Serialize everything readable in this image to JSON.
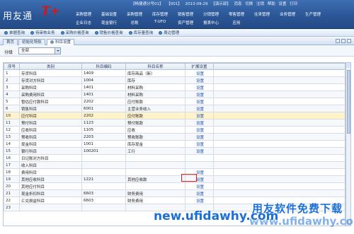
{
  "app": {
    "brand": "用友通",
    "product": "T+",
    "status": [
      "【畅捷通分号01】",
      "【001】",
      "2013-09-29",
      "【演示部】",
      "消息",
      "切换",
      "注销",
      "帮助",
      "设置",
      "打印"
    ]
  },
  "menu": {
    "row1": [
      "采购管理",
      "基础设置",
      "采购管理",
      "库存管理",
      "销售管理",
      "分销管理",
      "零售管理",
      "往来管理",
      "业务管理",
      "生产管理"
    ],
    "row2": [
      "企业日志",
      "现金银行",
      "总账",
      "T-UFO",
      "资产管理",
      "报表中心",
      "应用"
    ]
  },
  "quickbar": [
    "单据查询",
    "待审核业务",
    "采购价格查询",
    "销售价格查询",
    "库存量查询",
    "周边管理"
  ],
  "tabs": [
    {
      "label": "首页",
      "active": false
    },
    {
      "label": "初始化导航",
      "active": false
    },
    {
      "label": "科目设置",
      "active": true
    }
  ],
  "filter": {
    "label": "分级",
    "value": "全部"
  },
  "table": {
    "headers": [
      "序号",
      "类别",
      "科目编码",
      "科目名称",
      "扩展设置"
    ],
    "rows": [
      [
        "1",
        "存货科目",
        "1409",
        "库存商品（新）",
        "设置"
      ],
      [
        "2",
        "存货对方科目",
        "1004",
        "库存",
        "设置"
      ],
      [
        "3",
        "采购科目",
        "1401",
        "材料采购",
        "设置"
      ],
      [
        "4",
        "采购费用科目",
        "1401",
        "材料采购",
        "设置"
      ],
      [
        "5",
        "暂估应付款科目",
        "2202",
        "应付账款",
        "设置"
      ],
      [
        "6",
        "销售科目",
        "6001",
        "主营业务收入",
        "设置"
      ],
      [
        "10",
        "应付科目",
        "2202",
        "应付账款",
        "设置"
      ],
      [
        "11",
        "预付科目",
        "1123",
        "预付账款",
        "设置"
      ],
      [
        "12",
        "应收科目",
        "1105",
        "应收",
        "设置"
      ],
      [
        "13",
        "预收科目",
        "2203",
        "预收账款",
        "设置"
      ],
      [
        "14",
        "现金科目",
        "1001",
        "库存现金",
        "设置"
      ],
      [
        "15",
        "银行科目",
        "100201",
        "工行",
        "设置"
      ],
      [
        "16",
        "日记账对方科目",
        "",
        "",
        ""
      ],
      [
        "17",
        "收入科目",
        "",
        "",
        ""
      ],
      [
        "18",
        "费用科目",
        "",
        "",
        "设置"
      ],
      [
        "19",
        "其他应收科目",
        "1221",
        "其他应收款",
        "设置"
      ],
      [
        "20",
        "其他应付科目",
        "",
        "",
        "设置"
      ],
      [
        "21",
        "现金折扣科目",
        "6603",
        "财务费用",
        "设置"
      ],
      [
        "22",
        "汇兑损益科目",
        "6603",
        "财务费用",
        "设置"
      ],
      [
        "23",
        "",
        "",
        "",
        ""
      ]
    ]
  },
  "watermark": {
    "cn": "用友软件免费下载",
    "url": "new.ufidawhy.com",
    "url2": "www.ufidawhy.com"
  }
}
